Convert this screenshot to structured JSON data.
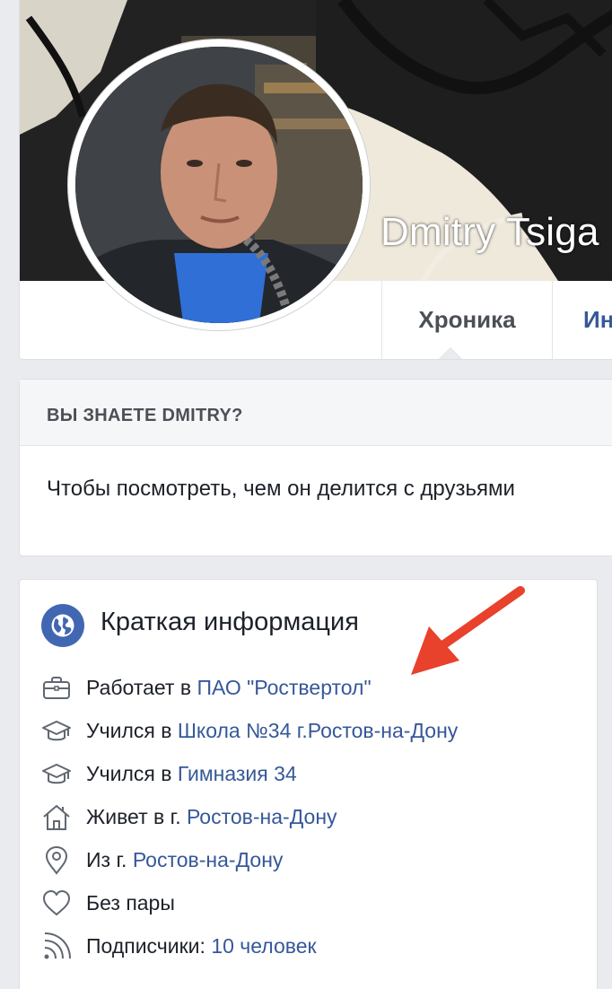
{
  "profile": {
    "name": "Dmitry Tsiga",
    "tabs": [
      {
        "label": "Хроника",
        "active": true
      },
      {
        "label": "Ин",
        "active": false
      }
    ]
  },
  "know_card": {
    "heading": "ВЫ ЗНАЕТЕ DMITRY?",
    "text": "Чтобы посмотреть, чем он делится с друзьями"
  },
  "intro": {
    "title": "Краткая информация",
    "items": [
      {
        "icon": "briefcase-icon",
        "label": "Работает в ",
        "link": "ПАО \"Роствертол\""
      },
      {
        "icon": "graduation-cap-icon",
        "label": "Учился в ",
        "link": "Школа №34 г.Ростов-на-Дону"
      },
      {
        "icon": "graduation-cap-icon",
        "label": "Учился в ",
        "link": "Гимназия 34"
      },
      {
        "icon": "home-icon",
        "label": "Живет в г. ",
        "link": "Ростов-на-Дону"
      },
      {
        "icon": "map-pin-icon",
        "label": "Из г. ",
        "link": "Ростов-на-Дону"
      },
      {
        "icon": "heart-icon",
        "label": "Без пары",
        "link": ""
      },
      {
        "icon": "rss-icon",
        "label": "Подписчики: ",
        "link": "10 человек"
      }
    ]
  },
  "colors": {
    "link": "#365899",
    "accent": "#4267b2",
    "arrow": "#e8412c",
    "page_bg": "#e9ebee"
  }
}
